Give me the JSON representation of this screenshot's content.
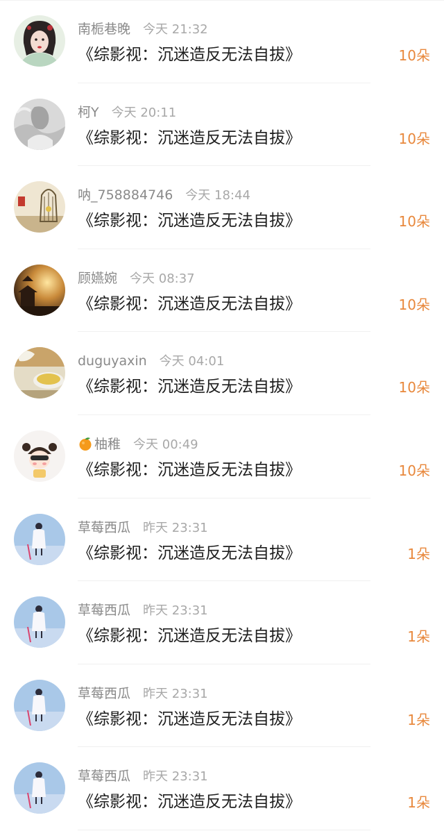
{
  "gift_list": {
    "items": [
      {
        "username": "南栀巷晚",
        "time": "今天 21:32",
        "book_title": "《综影视：沉迷造反无法自拔》",
        "amount": "10朵",
        "avatar": "girl-portrait-avatar"
      },
      {
        "username": "柯Y",
        "time": "今天 20:11",
        "book_title": "《综影视：沉迷造反无法自拔》",
        "amount": "10朵",
        "avatar": "grey-figure-avatar"
      },
      {
        "username": "呐_758884746",
        "time": "今天 18:44",
        "book_title": "《综影视：沉迷造反无法自拔》",
        "amount": "10朵",
        "avatar": "birdcage-avatar"
      },
      {
        "username": "顾嬿婉",
        "time": "今天 08:37",
        "book_title": "《综影视：沉迷造反无法自拔》",
        "amount": "10朵",
        "avatar": "palace-sunset-avatar"
      },
      {
        "username": "duguyaxin",
        "time": "今天 04:01",
        "book_title": "《综影视：沉迷造反无法自拔》",
        "amount": "10朵",
        "avatar": "tea-cup-avatar"
      },
      {
        "username": "柚稚",
        "username_icon": "orange-emoji",
        "time": "今天 00:49",
        "book_title": "《综影视：沉迷造反无法自拔》",
        "amount": "10朵",
        "avatar": "cartoon-girl-avatar"
      },
      {
        "username": "草莓西瓜",
        "time": "昨天 23:31",
        "book_title": "《综影视：沉迷造反无法自拔》",
        "amount": "1朵",
        "avatar": "blue-sky-figure-avatar"
      },
      {
        "username": "草莓西瓜",
        "time": "昨天 23:31",
        "book_title": "《综影视：沉迷造反无法自拔》",
        "amount": "1朵",
        "avatar": "blue-sky-figure-avatar"
      },
      {
        "username": "草莓西瓜",
        "time": "昨天 23:31",
        "book_title": "《综影视：沉迷造反无法自拔》",
        "amount": "1朵",
        "avatar": "blue-sky-figure-avatar"
      },
      {
        "username": "草莓西瓜",
        "time": "昨天 23:31",
        "book_title": "《综影视：沉迷造反无法自拔》",
        "amount": "1朵",
        "avatar": "blue-sky-figure-avatar"
      }
    ]
  },
  "colors": {
    "amount": "#e8883c",
    "username": "#8a8a8a",
    "time": "#a8a8a8",
    "title": "#1e1e1e"
  }
}
